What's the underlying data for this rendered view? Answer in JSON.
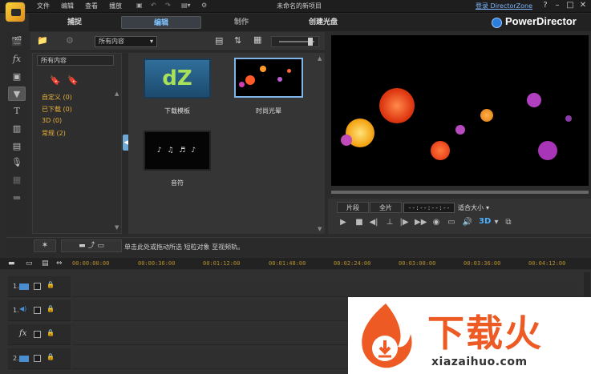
{
  "window": {
    "title": "未命名的新项目",
    "login": "登录 DirectorZone",
    "help": "?",
    "minimize": "–",
    "maximize": "□",
    "close": "✕"
  },
  "menu": [
    "文件",
    "编辑",
    "查看",
    "播放"
  ],
  "modes": [
    "捕捉",
    "编辑",
    "制作",
    "创建光盘"
  ],
  "brand": "PowerDirector",
  "library": {
    "dropdown": "所有内容",
    "pane_head": "所有内容",
    "categories": [
      "自定义 (0)",
      "已下载 (0)",
      "3D (0)",
      "常规 (2)"
    ],
    "items": [
      {
        "label": "下载模板",
        "thumb_text": "dZ"
      },
      {
        "label": "时尚光晕"
      },
      {
        "label": "音符"
      }
    ]
  },
  "preview": {
    "clip_button": "片段",
    "movie_button": "全片",
    "timecode": "--:--:--:--",
    "fit": "适合大小",
    "mode_3d": "3D"
  },
  "hint": "单击此处或拖动所选 短粒对象 至视频轨。",
  "timeline": {
    "ruler": [
      "00:00:00:00",
      "00:00:36:00",
      "00:01:12:00",
      "00:01:48:00",
      "00:02:24:00",
      "00:03:00:00",
      "00:03:36:00",
      "00:04:12:00"
    ],
    "tracks": [
      "1.",
      "1.",
      "fx",
      "2."
    ]
  },
  "watermark": {
    "text": "下载火",
    "url": "xiazaihuo.com"
  },
  "colors": {
    "accent": "#7fc3ff",
    "category": "#e8b03a",
    "ruler": "#b58d2b",
    "watermark": "#ee5a24"
  }
}
